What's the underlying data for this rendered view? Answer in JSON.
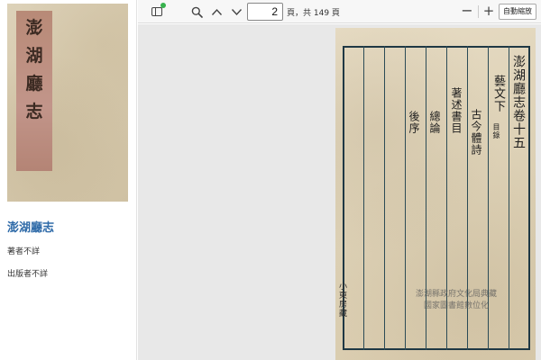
{
  "left_panel": {
    "cover_label_chars": [
      "澎",
      "湖",
      "廳",
      "志"
    ],
    "title": "澎湖廳志",
    "author": "著者不詳",
    "publisher": "出版者不詳"
  },
  "toolbar": {
    "page_value": "2",
    "page_count": "頁，共 149 頁",
    "zoom_out": "−",
    "zoom_in": "+",
    "zoom_mode": "自動縮放",
    "icons": [
      "sidebar-toggle-icon",
      "search-icon",
      "chevron-up-icon",
      "chevron-down-icon"
    ]
  },
  "page_content": {
    "title_col": "澎湖廳志卷十五",
    "section_col": "藝文下",
    "mulu": "目錄",
    "poem_col": "古今體詩",
    "books_col": "著述書目",
    "lunzong_col": "總論",
    "houxu_col": "後序",
    "side_text": "小東房藏",
    "watermark_line1": "澎湖縣政府文化局典藏",
    "watermark_line2": "國家圖書館數位化"
  },
  "colors": {
    "title_link": "#2e6aa8",
    "status_dot": "#37b24d",
    "viewer_bg": "#e8e8e8"
  }
}
